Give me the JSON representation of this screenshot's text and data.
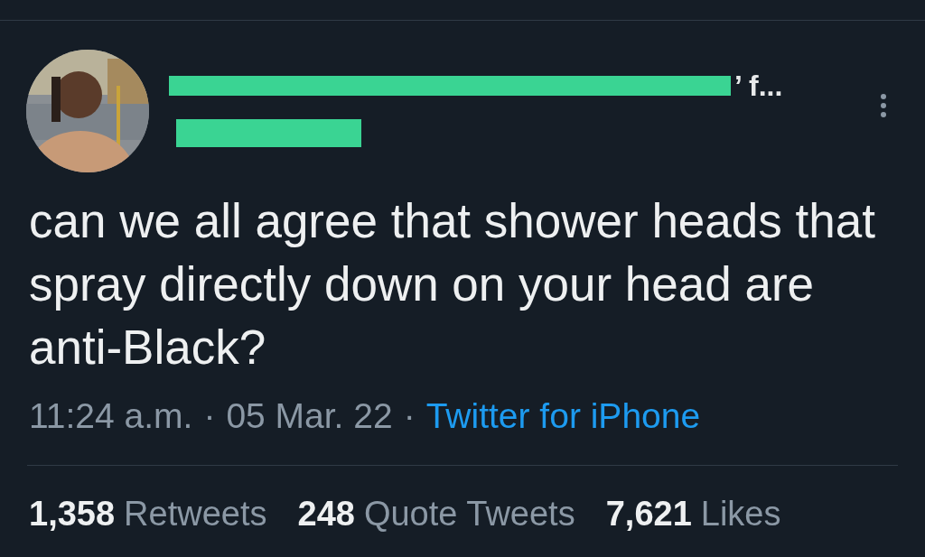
{
  "author": {
    "display_name": "’ f...",
    "name_redacted": true,
    "handle_redacted": true
  },
  "tweet": {
    "text": "can we all agree that shower heads that spray directly down on your head are anti-Black?"
  },
  "meta": [
    {
      "kind": "plain",
      "text": "11:24 a.m."
    },
    {
      "kind": "separator",
      "text": "·"
    },
    {
      "kind": "plain",
      "text": "05 Mar. 22"
    },
    {
      "kind": "separator",
      "text": "·"
    },
    {
      "kind": "link",
      "text": "Twitter for iPhone"
    }
  ],
  "stats": [
    {
      "count": "1,358",
      "label": "Retweets"
    },
    {
      "count": "248",
      "label": "Quote Tweets"
    },
    {
      "count": "7,621",
      "label": "Likes"
    }
  ]
}
